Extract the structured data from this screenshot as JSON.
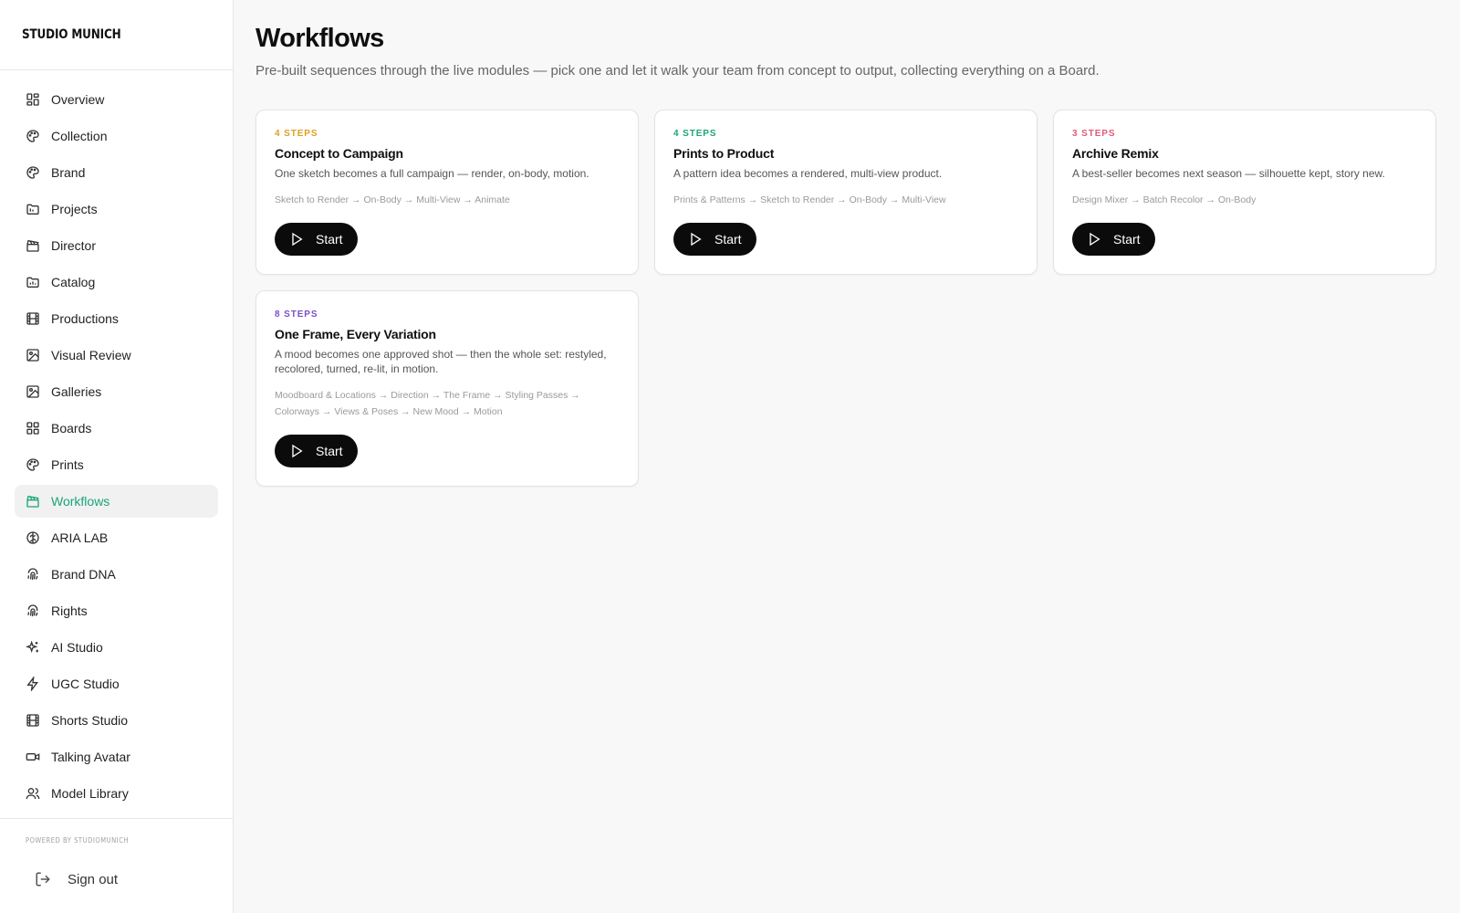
{
  "brand": {
    "name": "STUDIO MUNICH"
  },
  "sidebar": {
    "items": [
      {
        "label": "Overview",
        "icon": "grid-icon"
      },
      {
        "label": "Collection",
        "icon": "palette-icon"
      },
      {
        "label": "Brand",
        "icon": "palette-icon"
      },
      {
        "label": "Projects",
        "icon": "folder-icon"
      },
      {
        "label": "Director",
        "icon": "clapperboard-icon"
      },
      {
        "label": "Catalog",
        "icon": "folder-chart-icon"
      },
      {
        "label": "Productions",
        "icon": "film-icon"
      },
      {
        "label": "Visual Review",
        "icon": "image-icon"
      },
      {
        "label": "Galleries",
        "icon": "image-icon"
      },
      {
        "label": "Boards",
        "icon": "grid-icon"
      },
      {
        "label": "Prints",
        "icon": "palette-icon"
      },
      {
        "label": "Workflows",
        "icon": "clapperboard-icon",
        "active": true
      },
      {
        "label": "ARIA LAB",
        "icon": "brain-icon"
      },
      {
        "label": "Brand DNA",
        "icon": "fingerprint-icon"
      },
      {
        "label": "Rights",
        "icon": "fingerprint-icon"
      },
      {
        "label": "AI Studio",
        "icon": "sparkles-icon"
      },
      {
        "label": "UGC Studio",
        "icon": "zap-icon"
      },
      {
        "label": "Shorts Studio",
        "icon": "film-icon"
      },
      {
        "label": "Talking Avatar",
        "icon": "video-icon"
      },
      {
        "label": "Model Library",
        "icon": "users-icon"
      }
    ],
    "powered_by": "POWERED BY STUDIOMUNICH",
    "sign_out": "Sign out"
  },
  "main": {
    "title": "Workflows",
    "subtitle": "Pre-built sequences through the live modules — pick one and let it walk your team from concept to output, collecting everything on a Board.",
    "cards": [
      {
        "steps": "4 STEPS",
        "steps_color": "#e0a020",
        "title": "Concept to Campaign",
        "description": "One sketch becomes a full campaign — render, on-body, motion.",
        "flow": "Sketch to Render → On-Body → Multi-View → Animate",
        "button": "Start"
      },
      {
        "steps": "4 STEPS",
        "steps_color": "#1aa57b",
        "title": "Prints to Product",
        "description": "A pattern idea becomes a rendered, multi-view product.",
        "flow": "Prints & Patterns → Sketch to Render → On-Body → Multi-View",
        "button": "Start"
      },
      {
        "steps": "3 STEPS",
        "steps_color": "#e05a7a",
        "title": "Archive Remix",
        "description": "A best-seller becomes next season — silhouette kept, story new.",
        "flow": "Design Mixer → Batch Recolor → On-Body",
        "button": "Start"
      },
      {
        "steps": "8 STEPS",
        "steps_color": "#7b4fc8",
        "title": "One Frame, Every Variation",
        "description": "A mood becomes one approved shot — then the whole set: restyled, recolored, turned, re-lit, in motion.",
        "flow": "Moodboard & Locations → Direction → The Frame → Styling Passes → Colorways → Views & Poses → New Mood → Motion",
        "button": "Start"
      }
    ]
  }
}
